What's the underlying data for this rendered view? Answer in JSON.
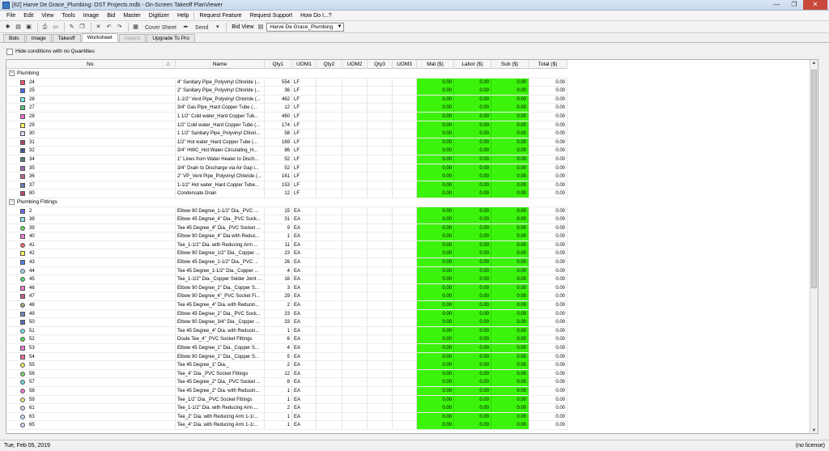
{
  "window": {
    "title": "[82] Harve De Grace_Plumbing: OST Projects.mdb - On-Screen Takeoff PlanViewer",
    "minimize": "—",
    "maximize": "❐",
    "close": "✕"
  },
  "menu": [
    "File",
    "Edit",
    "View",
    "Tools",
    "Image",
    "Bid",
    "Master",
    "Digitizer",
    "Help",
    "Request Feature",
    "Request Support",
    "How Do I...?"
  ],
  "toolbar": {
    "cover_sheet": "Cover Sheet",
    "send": "Send",
    "bid_view": "Bid View",
    "bid_selected": "Harve De Grace_Plumbing"
  },
  "tabs": [
    {
      "label": "Bids",
      "state": "normal"
    },
    {
      "label": "Image",
      "state": "normal"
    },
    {
      "label": "Takeoff",
      "state": "normal"
    },
    {
      "label": "Worksheet",
      "state": "active"
    },
    {
      "label": "Aspect",
      "state": "disabled"
    },
    {
      "label": "Upgrade To Pro",
      "state": "link"
    }
  ],
  "filter": {
    "hide_label": "Hide conditions with no Quantities"
  },
  "columns": [
    "No.",
    "Name",
    "Qty1",
    "UOM1",
    "Qty2",
    "UOM2",
    "Qty3",
    "UOM3",
    "Mat ($)",
    "Labor ($)",
    "Sub ($)",
    "Total ($)"
  ],
  "groups": [
    {
      "label": "Plumbing",
      "rows": [
        {
          "no": "24",
          "name": "4\" Sanitary Pipe_Polyvinyl Chloride (...",
          "qty1": "554",
          "uom1": "LF",
          "color": "#f04c6b",
          "shape": "square"
        },
        {
          "no": "25",
          "name": "2\" Sanitary Pipe_Polyvinyl Chloride (...",
          "qty1": "36",
          "uom1": "LF",
          "color": "#4a6cf5",
          "shape": "square"
        },
        {
          "no": "26",
          "name": "1-1/2\" Vent Pipe_Polyvinyl Chloride (...",
          "qty1": "462",
          "uom1": "LF",
          "color": "#7ee8e8",
          "shape": "square"
        },
        {
          "no": "27",
          "name": "3/4\" Gas Pipe_Hard Copper Tube (...",
          "qty1": "12",
          "uom1": "LF",
          "color": "#52c27a",
          "shape": "square"
        },
        {
          "no": "28",
          "name": "1 1/2\" Cold water_Hard Copper Tub...",
          "qty1": "460",
          "uom1": "LF",
          "color": "#f46ed8",
          "shape": "square"
        },
        {
          "no": "29",
          "name": "1/2\" Cold water_Hard Copper Tube (...",
          "qty1": "174",
          "uom1": "LF",
          "color": "#f5f05a",
          "shape": "square"
        },
        {
          "no": "30",
          "name": "1 1/2\" Sanitary Pipe_Polyvinyl Chlori...",
          "qty1": "58",
          "uom1": "LF",
          "color": "#d8d8f0",
          "shape": "square"
        },
        {
          "no": "31",
          "name": "1/2\" Hot water_Hard Copper Tube (...",
          "qty1": "169",
          "uom1": "LF",
          "color": "#a04a6a",
          "shape": "square"
        },
        {
          "no": "32",
          "name": "3/4\" HWC_Hot Water Circulating_H...",
          "qty1": "86",
          "uom1": "LF",
          "color": "#4a5a8a",
          "shape": "square"
        },
        {
          "no": "34",
          "name": "1\" Lines from Water Heater to Disch...",
          "qty1": "52",
          "uom1": "LF",
          "color": "#4a8a6a",
          "shape": "square"
        },
        {
          "no": "35",
          "name": "3/4\" Drain to Discharge via Air Gap i...",
          "qty1": "52",
          "uom1": "LF",
          "color": "#9a6ab8",
          "shape": "square"
        },
        {
          "no": "36",
          "name": "2\" VP_Vent Pipe_Polyvinyl Chloride (...",
          "qty1": "161",
          "uom1": "LF",
          "color": "#b86a8a",
          "shape": "square"
        },
        {
          "no": "37",
          "name": "1-1/2\" Hot water_Hard Copper Tube...",
          "qty1": "153",
          "uom1": "LF",
          "color": "#6a7ab8",
          "shape": "square"
        },
        {
          "no": "80",
          "name": "Condensate Drain",
          "qty1": "12",
          "uom1": "LF",
          "color": "#b84a6a",
          "shape": "square"
        }
      ]
    },
    {
      "label": "Plumbing Fittings",
      "rows": [
        {
          "no": "2",
          "name": "Elbow 90 Degree_1-1/2\" Dia._PVC ...",
          "qty1": "15",
          "uom1": "EA",
          "color": "#6a6af0",
          "shape": "square"
        },
        {
          "no": "38",
          "name": "Elbow 45 Degree_4\" Dia._PVC Sock...",
          "qty1": "31",
          "uom1": "EA",
          "color": "#8ae8e8",
          "shape": "square"
        },
        {
          "no": "39",
          "name": "Tee 45 Degree_4\" Dia._PVC Socket ...",
          "qty1": "9",
          "uom1": "EA",
          "color": "#5ad85a",
          "shape": "round"
        },
        {
          "no": "40",
          "name": "Elbow 90 Degree_4\" Dia with Reduc...",
          "qty1": "1",
          "uom1": "EA",
          "color": "#f07ad8",
          "shape": "square"
        },
        {
          "no": "41",
          "name": "Tee_1-1/2\" Dia. with Reducing Arm ...",
          "qty1": "11",
          "uom1": "EA",
          "color": "#f06a6a",
          "shape": "round"
        },
        {
          "no": "42",
          "name": "Elbow 90 Degree_1/2\" Dia._Copper ...",
          "qty1": "23",
          "uom1": "EA",
          "color": "#f5f05a",
          "shape": "square"
        },
        {
          "no": "43",
          "name": "Elbow 45 Degree_1-1/2\" Dia._PVC ...",
          "qty1": "26",
          "uom1": "EA",
          "color": "#5a7ae8",
          "shape": "square"
        },
        {
          "no": "44",
          "name": "Tee 45 Degree_1-1/2\" Dia._Copper ...",
          "qty1": "4",
          "uom1": "EA",
          "color": "#a8d8e8",
          "shape": "round"
        },
        {
          "no": "45",
          "name": "Tee_1-1/2\" Dia._Copper Solder Joint ...",
          "qty1": "16",
          "uom1": "EA",
          "color": "#5ad87a",
          "shape": "round"
        },
        {
          "no": "46",
          "name": "Elbow 90 Degree_2\" Dia._Copper S...",
          "qty1": "3",
          "uom1": "EA",
          "color": "#f07ad8",
          "shape": "square"
        },
        {
          "no": "47",
          "name": "Elbow 90 Degree_4\"_PVC Socket Fi...",
          "qty1": "29",
          "uom1": "EA",
          "color": "#c85a7a",
          "shape": "square"
        },
        {
          "no": "48",
          "name": "Tee 45 Degree_4\" Dia. with Reducin...",
          "qty1": "2",
          "uom1": "EA",
          "color": "#a8a878",
          "shape": "round"
        },
        {
          "no": "49",
          "name": "Elbow 45 Degree_2\" Dia._PVC Sock...",
          "qty1": "23",
          "uom1": "EA",
          "color": "#6a8ab8",
          "shape": "square"
        },
        {
          "no": "50",
          "name": "Elbow 90 Degree_3/4\" Dia._Copper ...",
          "qty1": "33",
          "uom1": "EA",
          "color": "#5a6ab8",
          "shape": "square"
        },
        {
          "no": "51",
          "name": "Tee 45 Degree_4\" Dia. with Reducin...",
          "qty1": "1",
          "uom1": "EA",
          "color": "#7ad8e8",
          "shape": "round"
        },
        {
          "no": "52",
          "name": "Doule Tee_4\"_PVC Socket Fittings",
          "qty1": "6",
          "uom1": "EA",
          "color": "#5ad85a",
          "shape": "round"
        },
        {
          "no": "53",
          "name": "Elbow 45 Degree_1\" Dia._Copper S...",
          "qty1": "4",
          "uom1": "EA",
          "color": "#f07ad8",
          "shape": "square"
        },
        {
          "no": "54",
          "name": "Elbow 90 Degree_1\" Dia._Copper S...",
          "qty1": "5",
          "uom1": "EA",
          "color": "#f06a8a",
          "shape": "square"
        },
        {
          "no": "55",
          "name": "Tee 45 Degree_1\" Dia._",
          "qty1": "2",
          "uom1": "EA",
          "color": "#e8e85a",
          "shape": "round"
        },
        {
          "no": "56",
          "name": "Tee_4\" Dia._PVC Socket Fittings",
          "qty1": "12",
          "uom1": "EA",
          "color": "#7ad87a",
          "shape": "round"
        },
        {
          "no": "57",
          "name": "Tee 45 Degree_2\" Dia._PVC Socket ...",
          "qty1": "8",
          "uom1": "EA",
          "color": "#6ad8c8",
          "shape": "round"
        },
        {
          "no": "58",
          "name": "Tee 45 Degree_2\" Dia. with Reducin...",
          "qty1": "1",
          "uom1": "EA",
          "color": "#f07ad8",
          "shape": "round"
        },
        {
          "no": "59",
          "name": "Tee_1/2\" Dia._PVC Socket Fittings",
          "qty1": "1",
          "uom1": "EA",
          "color": "#e8e87a",
          "shape": "round"
        },
        {
          "no": "61",
          "name": "Tee_1-1/2\" Dia. with Reducing Arm ...",
          "qty1": "2",
          "uom1": "EA",
          "color": "#d8c8e8",
          "shape": "round"
        },
        {
          "no": "63",
          "name": "Tee_2\" Dia. with Reducing Arm 1-1/...",
          "qty1": "1",
          "uom1": "EA",
          "color": "#c8d8f0",
          "shape": "round"
        },
        {
          "no": "65",
          "name": "Tee_4\" Dia. with Reducing Arm 1-1/...",
          "qty1": "1",
          "uom1": "EA",
          "color": "#d0d8f0",
          "shape": "round"
        }
      ]
    }
  ],
  "money_default": "0.00",
  "status": {
    "date": "Tue, Feb 05, 2019",
    "license": "(no license)"
  },
  "colors": {
    "cost_cells": "#3cf40b"
  }
}
